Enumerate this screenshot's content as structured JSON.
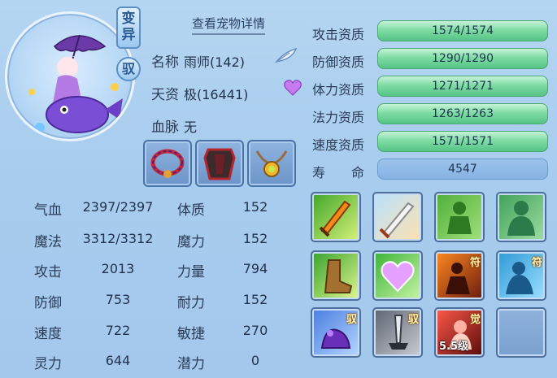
{
  "pet": {
    "detail_link": "查看宠物详情",
    "badge_mutant": "变异",
    "badge_tame": "驭",
    "name_label": "名称",
    "name_value": "雨师(142)",
    "talent_label": "天资",
    "talent_value": "极(16441)",
    "bloodline_label": "血脉",
    "bloodline_value": "无"
  },
  "stats": [
    {
      "label": "气血",
      "value": "2397/2397",
      "label2": "体质",
      "value2": "152"
    },
    {
      "label": "魔法",
      "value": "3312/3312",
      "label2": "魔力",
      "value2": "152"
    },
    {
      "label": "攻击",
      "value": "2013",
      "label2": "力量",
      "value2": "794"
    },
    {
      "label": "防御",
      "value": "753",
      "label2": "耐力",
      "value2": "152"
    },
    {
      "label": "速度",
      "value": "722",
      "label2": "敏捷",
      "value2": "270"
    },
    {
      "label": "灵力",
      "value": "644",
      "label2": "潜力",
      "value2": "0"
    }
  ],
  "aptitudes": [
    {
      "label": "攻击资质",
      "value": "1574/1574"
    },
    {
      "label": "防御资质",
      "value": "1290/1290"
    },
    {
      "label": "体力资质",
      "value": "1271/1271"
    },
    {
      "label": "法力资质",
      "value": "1263/1263"
    },
    {
      "label": "速度资质",
      "value": "1571/1571"
    },
    {
      "label": "寿　　命",
      "value": "4547"
    }
  ],
  "skills": [
    {
      "icon": "sword-fire-icon",
      "tag": ""
    },
    {
      "icon": "blade-slash-icon",
      "tag": ""
    },
    {
      "icon": "green-demon-icon",
      "tag": ""
    },
    {
      "icon": "green-spirit-icon",
      "tag": ""
    },
    {
      "icon": "boot-icon",
      "tag": ""
    },
    {
      "icon": "heart-glow-icon",
      "tag": ""
    },
    {
      "icon": "fire-warrior-icon",
      "tag": "符"
    },
    {
      "icon": "water-spirit-icon",
      "tag": "符"
    },
    {
      "icon": "purple-claw-icon",
      "tag": "驭"
    },
    {
      "icon": "dark-blade-icon",
      "tag": "驭"
    },
    {
      "icon": "red-awaken-icon",
      "tag": "觉",
      "level": "5.5级"
    },
    {
      "icon": "empty-slot",
      "tag": ""
    }
  ],
  "equipment": [
    "necklace-red-icon",
    "armor-dark-icon",
    "amulet-gold-icon"
  ],
  "colors": {
    "aptitude_bar": "#6ed49a",
    "panel_bg": "#a9cdee"
  }
}
